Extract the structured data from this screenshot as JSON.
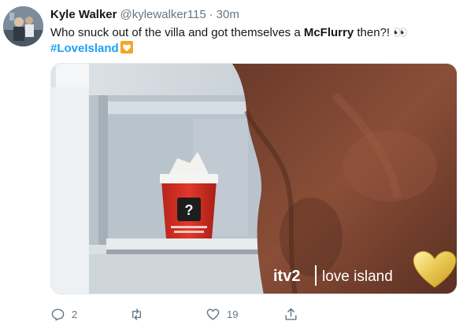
{
  "tweet": {
    "author_name": "Kyle Walker",
    "author_handle": "@kylewalker115",
    "separator": "·",
    "time": "30m",
    "text_before": "Who snuck out of the villa and got themselves a ",
    "text_bold": "McFlurry",
    "text_after": " then?!",
    "eyes_emoji": "👀",
    "hashtag": "#LoveIsland"
  },
  "media": {
    "watermark_itv": "itv2",
    "watermark_show": "love island",
    "cup_mark": "?"
  },
  "actions": {
    "reply_count": "2",
    "retweet_count": "",
    "like_count": "19"
  },
  "colors": {
    "accent": "#1da1f2",
    "muted": "#657786",
    "text": "#14171a"
  }
}
